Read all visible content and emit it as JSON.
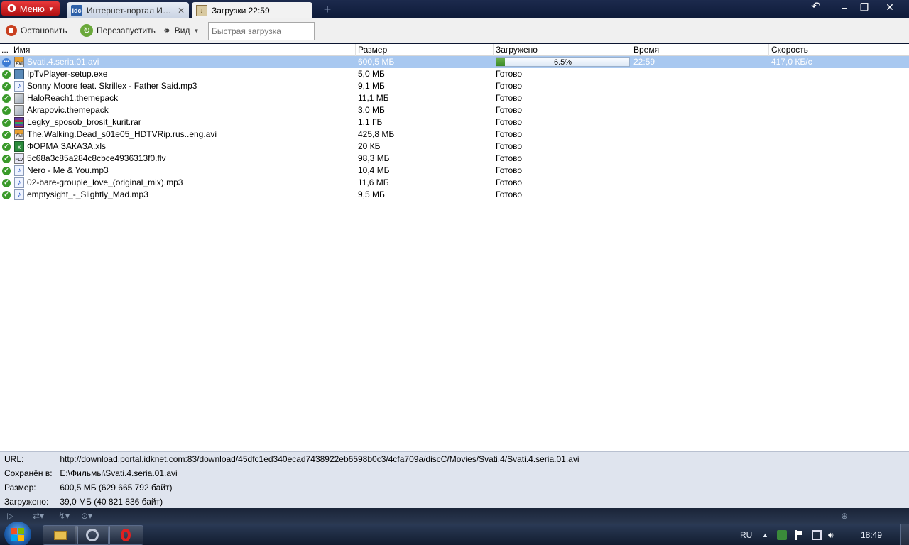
{
  "browser": {
    "menu_label": "Меню",
    "tabs": [
      {
        "label": "Интернет-портал ИД...",
        "favicon": "Idc"
      },
      {
        "label": "Загрузки 22:59"
      }
    ],
    "new_tab": "+",
    "controls": {
      "trash": "↶",
      "minimize": "–",
      "maximize": "❐",
      "close": "✕"
    }
  },
  "toolbar": {
    "stop_label": "Остановить",
    "restart_label": "Перезапустить",
    "view_label": "Вид",
    "quick_download_placeholder": "Быстрая загрузка"
  },
  "list": {
    "columns": {
      "menu": "...",
      "name": "Имя",
      "size": "Размер",
      "loaded": "Загружено",
      "time": "Время",
      "speed": "Скорость"
    },
    "rows": [
      {
        "name": "Svati.4.seria.01.avi",
        "size": "600,5 МБ",
        "loaded": "6.5%",
        "progress": 0.065,
        "time": "22:59",
        "speed": "417,0 КБ/с",
        "icon": "avi",
        "active": true
      },
      {
        "name": "IpTvPlayer-setup.exe",
        "size": "5,0 МБ",
        "loaded": "Готово",
        "icon": "exe"
      },
      {
        "name": "Sonny Moore feat. Skrillex - Father Said.mp3",
        "size": "9,1 МБ",
        "loaded": "Готово",
        "icon": "mp3"
      },
      {
        "name": "HaloReach1.themepack",
        "size": "11,1 МБ",
        "loaded": "Готово",
        "icon": "theme"
      },
      {
        "name": "Akrapovic.themepack",
        "size": "3,0 МБ",
        "loaded": "Готово",
        "icon": "theme"
      },
      {
        "name": "Legky_sposob_brosit_kurit.rar",
        "size": "1,1 ГБ",
        "loaded": "Готово",
        "icon": "rar"
      },
      {
        "name": "The.Walking.Dead_s01e05_HDTVRip.rus..eng.avi",
        "size": "425,8 МБ",
        "loaded": "Готово",
        "icon": "avi"
      },
      {
        "name": "ФОРМА ЗАКАЗА.xls",
        "size": "20 КБ",
        "loaded": "Готово",
        "icon": "xls"
      },
      {
        "name": "5c68a3c85a284c8cbce4936313f0.flv",
        "size": "98,3 МБ",
        "loaded": "Готово",
        "icon": "flv"
      },
      {
        "name": "Nero - Me & You.mp3",
        "size": "10,4 МБ",
        "loaded": "Готово",
        "icon": "mp3"
      },
      {
        "name": "02-bare-groupie_love_(original_mix).mp3",
        "size": "11,6 МБ",
        "loaded": "Готово",
        "icon": "mp3"
      },
      {
        "name": "emptysight_-_Slightly_Mad.mp3",
        "size": "9,5 МБ",
        "loaded": "Готово",
        "icon": "mp3"
      }
    ]
  },
  "details": {
    "url_label": "URL:",
    "url": "http://download.portal.idknet.com:83/download/45dfc1ed340ecad7438922eb6598b0c3/4cfa709a/discC/Movies/Svati.4/Svati.4.seria.01.avi",
    "saved_label": "Сохранён в:",
    "saved": "E:\\Фильмы\\Svati.4.seria.01.avi",
    "size_label": "Размер:",
    "size": "600,5 МБ (629 665 792 байт)",
    "loaded_label": "Загружено:",
    "loaded": "39,0 МБ (40 821 836 байт)"
  },
  "taskbar": {
    "language": "RU",
    "clock": "18:49"
  },
  "colors": {
    "selection": "#a8c8f0",
    "done_status": "#3a9a2a",
    "details_bg": "#dfe4ee"
  }
}
